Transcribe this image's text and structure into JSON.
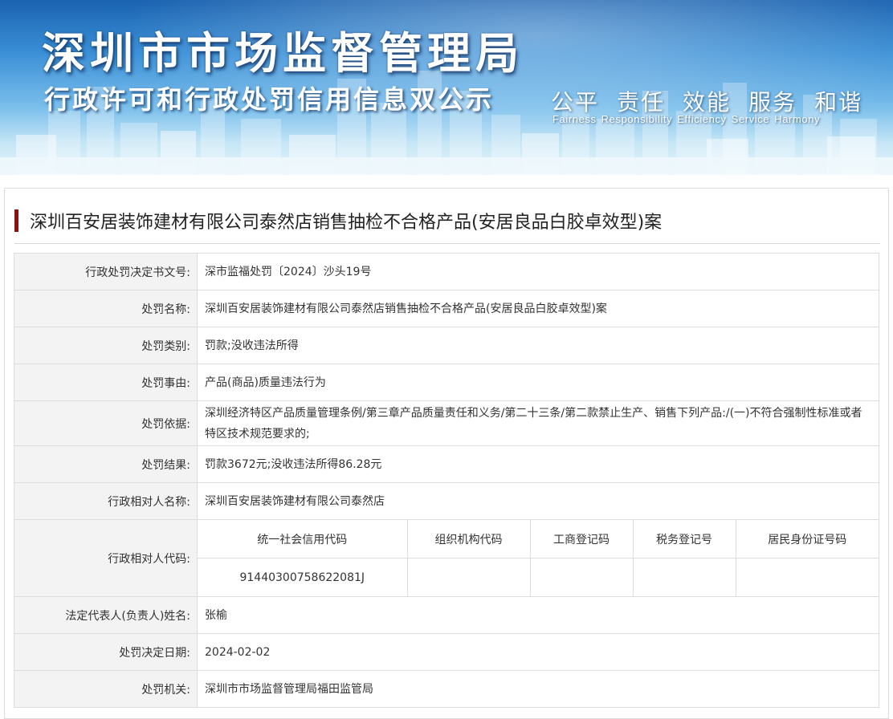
{
  "banner": {
    "title": "深圳市市场监督管理局",
    "subtitle": "行政许可和行政处罚信用信息双公示",
    "values_cn": [
      "公平",
      "责任",
      "效能",
      "服务",
      "和谐"
    ],
    "values_en": [
      "Fairness",
      "Responsibility",
      "Efficiency",
      "Service",
      "Harmony"
    ]
  },
  "case_title": "深圳百安居装饰建材有限公司泰然店销售抽检不合格产品(安居良品白胶卓效型)案",
  "rows": [
    {
      "label": "行政处罚决定书文号:",
      "value": "深市监福处罚〔2024〕沙头19号"
    },
    {
      "label": "处罚名称:",
      "value": "深圳百安居装饰建材有限公司泰然店销售抽检不合格产品(安居良品白胶卓效型)案"
    },
    {
      "label": "处罚类别:",
      "value": "罚款;没收违法所得"
    },
    {
      "label": "处罚事由:",
      "value": "产品(商品)质量违法行为"
    },
    {
      "label": "处罚依据:",
      "value": "深圳经济特区产品质量管理条例/第三章产品质量责任和义务/第二十三条/第二款禁止生产、销售下列产品:/(一)不符合强制性标准或者特区技术规范要求的;"
    },
    {
      "label": "处罚结果:",
      "value": "罚款3672元;没收违法所得86.28元"
    },
    {
      "label": "行政相对人名称:",
      "value": "深圳百安居装饰建材有限公司泰然店"
    }
  ],
  "codes": {
    "label": "行政相对人代码:",
    "headers": [
      "统一社会信用代码",
      "组织机构代码",
      "工商登记码",
      "税务登记号",
      "居民身份证号码"
    ],
    "values": [
      "91440300758622081J",
      "",
      "",
      "",
      ""
    ]
  },
  "rows_after": [
    {
      "label": "法定代表人(负责人)姓名:",
      "value": "张榆"
    },
    {
      "label": "处罚决定日期:",
      "value": "2024-02-02"
    },
    {
      "label": "处罚机关:",
      "value": "深圳市市场监督管理局福田监管局"
    }
  ],
  "colors": {
    "accent_bar": "#8b1212",
    "label_bg": "#f3f3f3",
    "border": "#dddddd"
  }
}
